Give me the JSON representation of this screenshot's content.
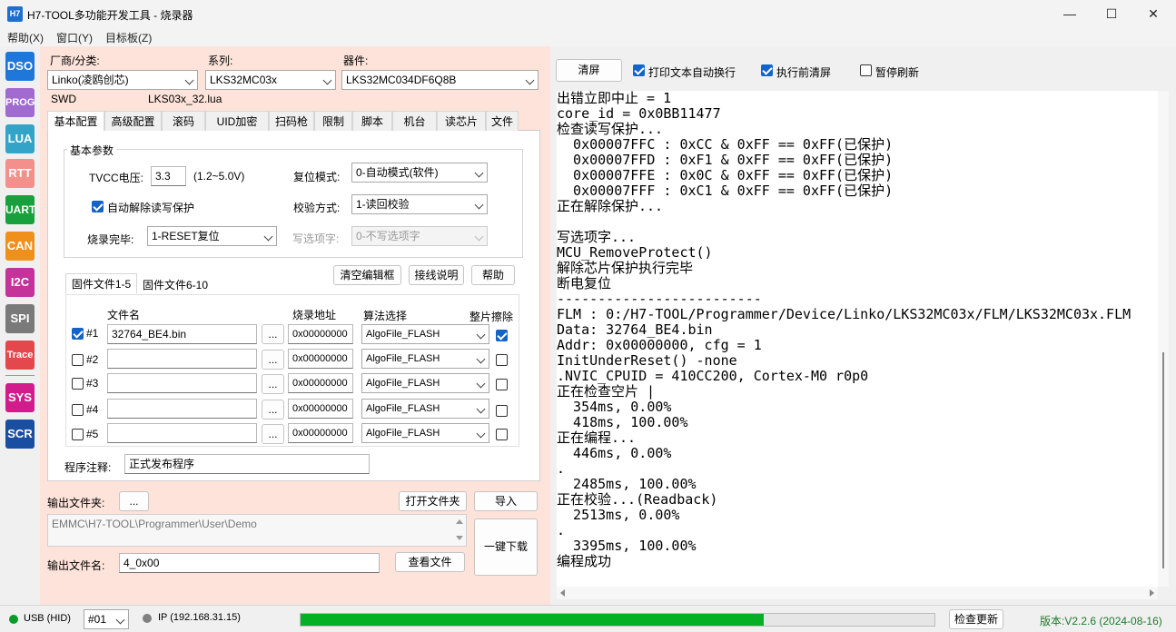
{
  "window": {
    "app_icon": "H7",
    "title": "H7-TOOL多功能开发工具 - 烧录器",
    "minimize_icon": "—",
    "maximize_icon": "☐",
    "close_icon": "✕"
  },
  "menu": [
    "帮助(X)",
    "窗口(Y)",
    "目标板(Z)"
  ],
  "nav": [
    {
      "label": "DSO",
      "color": "#1f77d9"
    },
    {
      "label": "PROG",
      "color": "#a06ad0"
    },
    {
      "label": "LUA",
      "color": "#34a3c8"
    },
    {
      "label": "RTT",
      "color": "#f4908c"
    },
    {
      "label": "UART",
      "color": "#18a03c"
    },
    {
      "label": "CAN",
      "color": "#f0901c"
    },
    {
      "label": "I2C",
      "color": "#c4329a"
    },
    {
      "label": "SPI",
      "color": "#7a7a7a"
    },
    {
      "label": "Trace",
      "color": "#e4484c"
    },
    {
      "label": "SYS",
      "color": "#d21c8c"
    },
    {
      "label": "SCR",
      "color": "#1a4ea0"
    }
  ],
  "selectors": {
    "vendor_label": "厂商/分类:",
    "vendor_value": "Linko(凌鸥创芯)",
    "series_label": "系列:",
    "series_value": "LKS32MC03x",
    "device_label": "器件:",
    "device_value": "LKS32MC034DF6Q8B",
    "interface": "SWD",
    "lua_file": "LKS03x_32.lua"
  },
  "tabs": [
    "基本配置",
    "高级配置",
    "滚码",
    "UID加密",
    "扫码枪",
    "限制",
    "脚本",
    "机台",
    "读芯片",
    "文件"
  ],
  "basic": {
    "group_title": "基本参数",
    "tvcc_label": "TVCC电压:",
    "tvcc_value": "3.3",
    "tvcc_range": "(1.2~5.0V)",
    "reset_label": "复位模式:",
    "reset_value": "0-自动模式(软件)",
    "auto_unprotect_label": "自动解除读写保护",
    "verify_label": "校验方式:",
    "verify_value": "1-读回校验",
    "after_label": "烧录完毕:",
    "after_value": "1-RESET复位",
    "option_label": "写选项字:",
    "option_value": "0-不写选项字"
  },
  "firmware": {
    "tab1": "固件文件1-5",
    "tab2": "固件文件6-10",
    "clear_btn": "清空编辑框",
    "wiring_btn": "接线说明",
    "help_btn": "帮助",
    "col_file": "文件名",
    "col_addr": "烧录地址",
    "col_algo": "算法选择",
    "col_erase": "整片擦除",
    "browse_label": "...",
    "rows": [
      {
        "id": "#1",
        "file": "32764_BE4.bin",
        "addr": "0x00000000",
        "algo": "AlgoFile_FLASH"
      },
      {
        "id": "#2",
        "file": "",
        "addr": "0x00000000",
        "algo": "AlgoFile_FLASH"
      },
      {
        "id": "#3",
        "file": "",
        "addr": "0x00000000",
        "algo": "AlgoFile_FLASH"
      },
      {
        "id": "#4",
        "file": "",
        "addr": "0x00000000",
        "algo": "AlgoFile_FLASH"
      },
      {
        "id": "#5",
        "file": "",
        "addr": "0x00000000",
        "algo": "AlgoFile_FLASH"
      }
    ],
    "note_label": "程序注释:",
    "note_value": "正式发布程序"
  },
  "output": {
    "folder_label": "输出文件夹:",
    "browse_btn": "...",
    "open_btn": "打开文件夹",
    "import_btn": "导入",
    "path": "EMMC\\H7-TOOL\\Programmer\\User\\Demo",
    "download_btn": "一键下载",
    "name_label": "输出文件名:",
    "name_value": "4_0x00",
    "view_btn": "查看文件"
  },
  "log_toolbar": {
    "clear_btn": "清屏",
    "wrap_label": "打印文本自动换行",
    "preclear_label": "执行前清屏",
    "pause_label": "暂停刷新"
  },
  "log": [
    "出错立即中止 = 1",
    "core_id = 0x0BB11477",
    "检查读写保护...",
    "  0x00007FFC : 0xCC & 0xFF == 0xFF(已保护)",
    "  0x00007FFD : 0xF1 & 0xFF == 0xFF(已保护)",
    "  0x00007FFE : 0x0C & 0xFF == 0xFF(已保护)",
    "  0x00007FFF : 0xC1 & 0xFF == 0xFF(已保护)",
    "正在解除保护...",
    "",
    "写选项字...",
    "MCU_RemoveProtect()",
    "解除芯片保护执行完毕",
    "断电复位",
    "-------------------------",
    "FLM : 0:/H7-TOOL/Programmer/Device/Linko/LKS32MC03x/FLM/LKS32MC03x.FLM",
    "Data: 32764_BE4.bin",
    "Addr: 0x00000000, cfg = 1",
    "InitUnderReset() -none",
    ".NVIC_CPUID = 410CC200, Cortex-M0 r0p0",
    "正在检查空片 |",
    "  354ms, 0.00%",
    "  418ms, 100.00%",
    "正在编程...",
    "  446ms, 0.00%",
    ".",
    "  2485ms, 100.00%",
    "正在校验...(Readback)",
    "  2513ms, 0.00%",
    ".",
    "  3395ms, 100.00%",
    "编程成功"
  ],
  "status": {
    "usb": "USB (HID)",
    "port": "#01",
    "ip": "IP (192.168.31.15)",
    "progress": 0.73,
    "check_update": "检查更新",
    "version": "版本:V2.2.6 (2024-08-16)"
  }
}
